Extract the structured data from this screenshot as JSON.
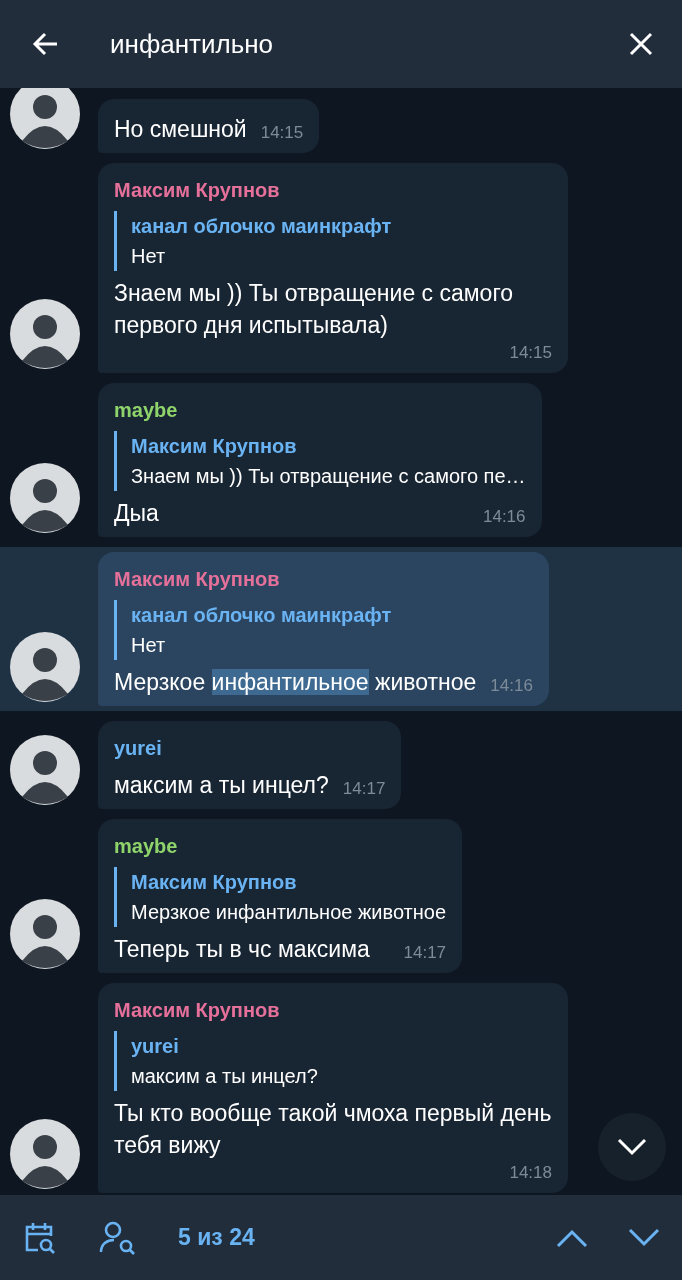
{
  "header": {
    "query": "инфантильно"
  },
  "messages": [
    {
      "selected": false,
      "text": [
        {
          "t": "Но смешной",
          "highlighted": false
        }
      ],
      "time": "14:15"
    },
    {
      "selected": false,
      "sender": {
        "name": "Максим Крупнов",
        "color": "#e5709a"
      },
      "reply": {
        "name": "канал облочко маинкрафт",
        "text": "Нет"
      },
      "text": [
        {
          "t": "Знаем мы )) Ты отвращение с самого первого дня испытывала)",
          "highlighted": false
        }
      ],
      "time": "14:15"
    },
    {
      "selected": false,
      "sender": {
        "name": "maybe",
        "color": "#8fd46a"
      },
      "reply": {
        "name": "Максим Крупнов",
        "text": "Знаем мы )) Ты отвращение с самого пе…"
      },
      "text": [
        {
          "t": "Дыа",
          "highlighted": false
        }
      ],
      "time": "14:16"
    },
    {
      "selected": true,
      "sender": {
        "name": "Максим Крупнов",
        "color": "#e5709a"
      },
      "reply": {
        "name": "канал облочко маинкрафт",
        "text": "Нет"
      },
      "text": [
        {
          "t": "Мерзкое ",
          "highlighted": false
        },
        {
          "t": "инфантильное",
          "highlighted": true
        },
        {
          "t": " животное",
          "highlighted": false
        }
      ],
      "time": "14:16"
    },
    {
      "selected": false,
      "sender": {
        "name": "yurei",
        "color": "#6ab3f3"
      },
      "text": [
        {
          "t": "максим а ты инцел?",
          "highlighted": false
        }
      ],
      "time": "14:17"
    },
    {
      "selected": false,
      "sender": {
        "name": "maybe",
        "color": "#8fd46a"
      },
      "reply": {
        "name": "Максим Крупнов",
        "text": "Мерзкое инфантильное животное"
      },
      "text": [
        {
          "t": "Теперь ты в чс максима",
          "highlighted": false
        }
      ],
      "time": "14:17"
    },
    {
      "selected": false,
      "sender": {
        "name": "Максим Крупнов",
        "color": "#e5709a"
      },
      "reply": {
        "name": "yurei",
        "text": "максим а ты инцел?"
      },
      "text": [
        {
          "t": "Ты кто вообще такой чмоха первый день тебя вижу",
          "highlighted": false
        }
      ],
      "time": "14:18"
    }
  ],
  "footer": {
    "counter": "5 из 24"
  }
}
